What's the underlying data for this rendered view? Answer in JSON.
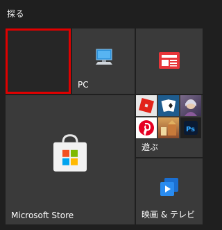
{
  "group": {
    "title": "探る"
  },
  "tiles": {
    "empty": {
      "label": ""
    },
    "pc": {
      "label": "PC",
      "icon": "pc-icon"
    },
    "news": {
      "label": "",
      "icon": "news-icon"
    },
    "store": {
      "label": "Microsoft Store",
      "icon": "store-bag-icon"
    },
    "games": {
      "label": "遊ぶ",
      "icons": [
        "roblox-icon",
        "solitaire-icon",
        "game-icon",
        "pinterest-icon",
        "game-icon",
        "photoshop-icon"
      ]
    },
    "movies": {
      "label": "映画 & テレビ",
      "icon": "movies-tv-icon"
    }
  },
  "colors": {
    "selection": "#e00000",
    "tile": "#3a3a3a",
    "background": "#1f1f1f"
  }
}
